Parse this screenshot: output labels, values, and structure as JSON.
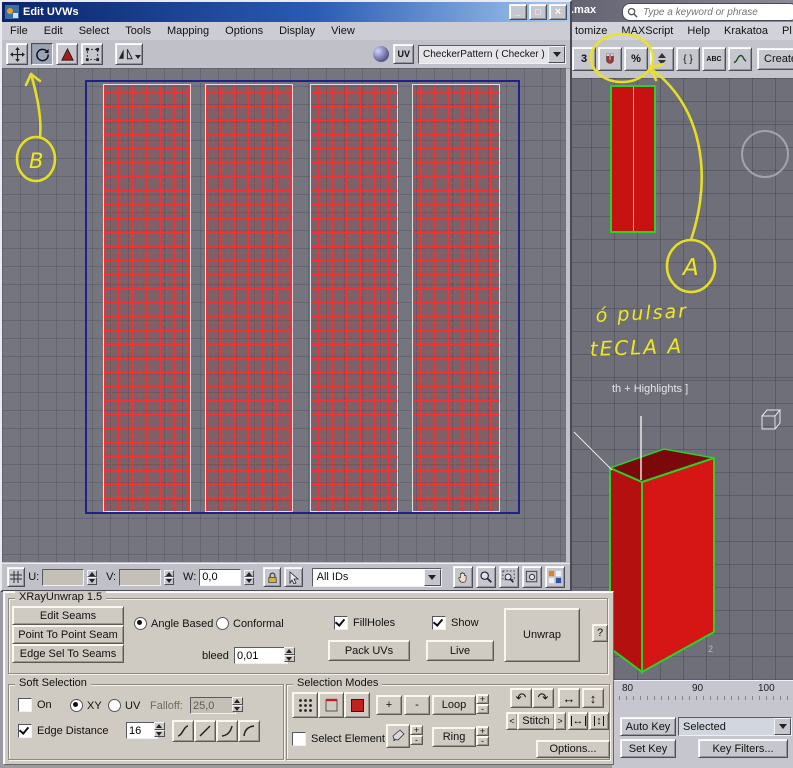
{
  "uvw_window": {
    "title": "Edit UVWs",
    "window_buttons": {
      "min": "_",
      "max": "□",
      "close": "×"
    },
    "menu": [
      "File",
      "Edit",
      "Select",
      "Tools",
      "Mapping",
      "Options",
      "Display",
      "View"
    ],
    "toolbar": {
      "uv_label": "UV",
      "texture_dropdown": "CheckerPattern  ( Checker )"
    },
    "bottom_bar": {
      "u_label": "U:",
      "v_label": "V:",
      "w_label": "W:",
      "w_value": "0,0",
      "id_filter": "All IDs"
    }
  },
  "xray_panel": {
    "title": "XRayUnwrap 1.5",
    "edit_seams": "Edit Seams",
    "point_to_point": "Point To Point Seam",
    "edge_sel": "Edge Sel To Seams",
    "angle_based": "Angle Based",
    "conformal": "Conformal",
    "bleed_label": "bleed",
    "bleed_value": "0,01",
    "fillholes": "FillHoles",
    "show": "Show",
    "pack_uvs": "Pack UVs",
    "live": "Live",
    "unwrap": "Unwrap",
    "help": "?"
  },
  "soft_selection": {
    "title": "Soft Selection",
    "on": "On",
    "xy": "XY",
    "uv": "UV",
    "falloff_label": "Falloff:",
    "falloff_value": "25,0",
    "edge_distance": "Edge Distance",
    "edge_value": "16"
  },
  "selection_modes": {
    "title": "Selection Modes",
    "plus": "+",
    "minus": "-",
    "loop": "Loop",
    "ring": "Ring",
    "select_element": "Select Element",
    "stitch": "Stitch",
    "stitch_prev": "<",
    "stitch_next": ">",
    "options": "Options...",
    "icons": {
      "rotate_left": "↶",
      "rotate_right": "↷",
      "h_arrow": "↔",
      "v_arrow": "↕"
    }
  },
  "max_ui": {
    "title_fragment": ".max",
    "search_placeholder": "Type a keyword or phrase",
    "menu": [
      "tomize",
      "MAXScript",
      "Help",
      "Krakatoa",
      "Pl"
    ],
    "toolbar": {
      "snap_number": "3",
      "percent": "%",
      "braces": "{ }",
      "abc": "ABC",
      "create_button": "Create S"
    },
    "viewport_label": "th + Highlights ]",
    "viewport_axis_label": "2",
    "timeline": [
      "80",
      "90",
      "100"
    ],
    "controls": {
      "auto_key": "Auto Key",
      "selected": "Selected",
      "set_key": "Set Key",
      "key_filters": "Key Filters..."
    }
  },
  "annotations": {
    "b": "B",
    "a": "A",
    "note_line1": "ó pulsar",
    "note_line2": "tECLA A"
  }
}
